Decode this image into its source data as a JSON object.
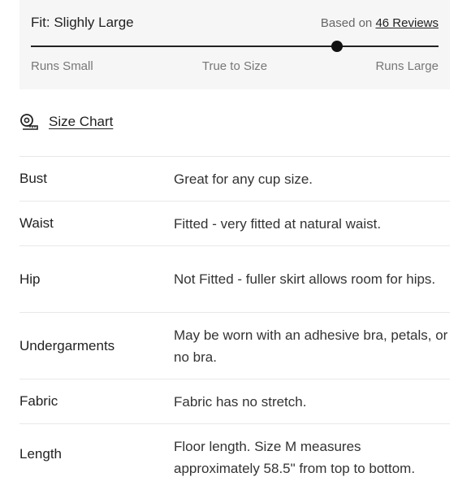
{
  "fit": {
    "title": "Fit: Slighly Large",
    "reviews_prefix": "Based on",
    "reviews_link": "46 Reviews",
    "scale_left": "Runs Small",
    "scale_mid": "True to Size",
    "scale_right": "Runs Large",
    "position_fraction": 0.75
  },
  "size_chart": {
    "icon": "measuring-tape-icon",
    "label": "Size Chart"
  },
  "details": [
    {
      "label": "Bust",
      "value": "Great for any cup size."
    },
    {
      "label": "Waist",
      "value": "Fitted - very fitted at natural waist."
    },
    {
      "label": "Hip",
      "value": "Not Fitted - fuller skirt allows room for hips."
    },
    {
      "label": "Undergarments",
      "value": "May be worn with an adhesive bra, petals, or no bra."
    },
    {
      "label": "Fabric",
      "value": "Fabric has no stretch."
    },
    {
      "label": "Length",
      "value": "Floor length. Size M measures approximately 58.5\" from top to bottom."
    }
  ]
}
